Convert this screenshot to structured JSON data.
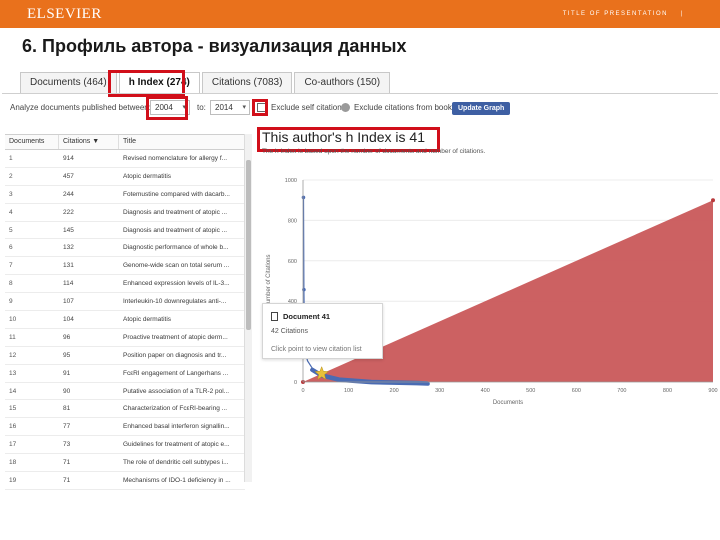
{
  "header": {
    "logo": "ELSEVIER",
    "deck_title": "TITLE OF PRESENTATION",
    "page_marker": "|"
  },
  "slide_title": "6. Профиль автора - визуализация данных",
  "tabs": [
    {
      "label": "Documents (464)"
    },
    {
      "label": "h Index (274)"
    },
    {
      "label": "Citations (7083)"
    },
    {
      "label": "Co-authors (150)"
    }
  ],
  "filters": {
    "analyze_label": "Analyze documents published between:",
    "from_year": "2004",
    "to_label": "to:",
    "to_year": "2014",
    "exclude_self_label": "Exclude self citations",
    "exclude_books_label": "Exclude citations from books",
    "update_button": "Update Graph"
  },
  "table": {
    "headers": [
      "Documents",
      "Citations",
      "Title"
    ],
    "sort_indicator": "▼",
    "rows": [
      {
        "n": "1",
        "cit": "914",
        "title": "Revised nomenclature for allergy f..."
      },
      {
        "n": "2",
        "cit": "457",
        "title": "Atopic dermatitis"
      },
      {
        "n": "3",
        "cit": "244",
        "title": "Fotemustine compared with dacarb..."
      },
      {
        "n": "4",
        "cit": "222",
        "title": "Diagnosis and treatment of atopic ..."
      },
      {
        "n": "5",
        "cit": "145",
        "title": "Diagnosis and treatment of atopic ..."
      },
      {
        "n": "6",
        "cit": "132",
        "title": "Diagnostic performance of whole b..."
      },
      {
        "n": "7",
        "cit": "131",
        "title": "Genome-wide scan on total serum ..."
      },
      {
        "n": "8",
        "cit": "114",
        "title": "Enhanced expression levels of IL-3..."
      },
      {
        "n": "9",
        "cit": "107",
        "title": "Interleukin-10 downregulates anti-..."
      },
      {
        "n": "10",
        "cit": "104",
        "title": "Atopic dermatitis"
      },
      {
        "n": "11",
        "cit": "96",
        "title": "Proactive treatment of atopic derm..."
      },
      {
        "n": "12",
        "cit": "95",
        "title": "Position paper on diagnosis and tr..."
      },
      {
        "n": "13",
        "cit": "91",
        "title": "FcεRI engagement of Langerhans ..."
      },
      {
        "n": "14",
        "cit": "90",
        "title": "Putative association of a TLR-2 pol..."
      },
      {
        "n": "15",
        "cit": "81",
        "title": "Characterization of FcεRI-bearing ..."
      },
      {
        "n": "16",
        "cit": "77",
        "title": "Enhanced basal interferon signallin..."
      },
      {
        "n": "17",
        "cit": "73",
        "title": "Guidelines for treatment of atopic e..."
      },
      {
        "n": "18",
        "cit": "71",
        "title": "The role of dendritic cell subtypes i..."
      },
      {
        "n": "19",
        "cit": "71",
        "title": "Mechanisms of IDO-1 deficiency in ..."
      }
    ]
  },
  "chart_data": {
    "type": "area",
    "title": "This author's h Index is 41",
    "subtitle": "The h Index is based upon the number of documents and number of citations.",
    "xlabel": "Documents",
    "ylabel": "Number of Citations",
    "xlim": [
      0,
      900
    ],
    "ylim": [
      0,
      1000
    ],
    "x_ticks": [
      "0",
      "100",
      "200",
      "300",
      "400",
      "500",
      "600",
      "700",
      "800",
      "900"
    ],
    "y_ticks": [
      "0",
      "400",
      "600",
      "800",
      "1000"
    ],
    "colors": {
      "area": "#c9585a",
      "citations_line": "#4a6bb3",
      "h_index_marker": "#e8c13a"
    },
    "series": [
      {
        "type": "area",
        "points": [
          [
            0,
            0
          ],
          [
            900,
            900
          ]
        ]
      },
      {
        "type": "line",
        "points": [
          [
            1,
            914
          ],
          [
            2,
            457
          ],
          [
            3,
            244
          ],
          [
            4,
            222
          ],
          [
            5,
            145
          ],
          [
            10,
            104
          ],
          [
            20,
            70
          ],
          [
            41,
            41
          ],
          [
            80,
            20
          ],
          [
            150,
            8
          ],
          [
            250,
            3
          ],
          [
            274,
            1
          ]
        ]
      }
    ],
    "h_index": 41
  },
  "tooltip": {
    "title": "Document 41",
    "citations": "42 Citations",
    "link": "Click point to view citation list"
  }
}
